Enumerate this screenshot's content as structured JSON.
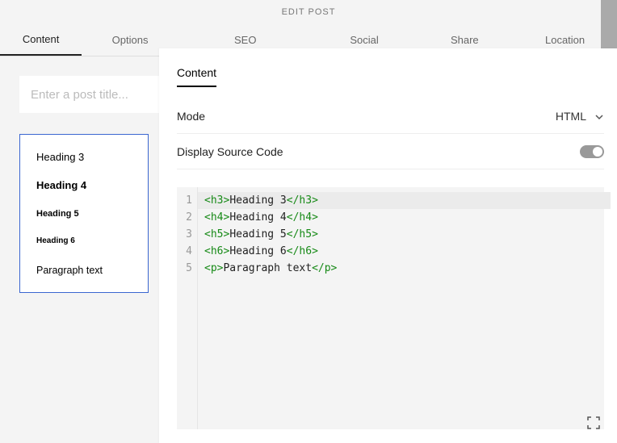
{
  "header": {
    "title": "EDIT POST"
  },
  "tabs": [
    {
      "label": "Content",
      "active": true
    },
    {
      "label": "Options"
    },
    {
      "label": "SEO"
    },
    {
      "label": "Social"
    },
    {
      "label": "Share"
    },
    {
      "label": "Location"
    }
  ],
  "title_input": {
    "placeholder": "Enter a post title..."
  },
  "preview": {
    "h3": "Heading 3",
    "h4": "Heading 4",
    "h5": "Heading 5",
    "h6": "Heading 6",
    "p": "Paragraph text"
  },
  "panel": {
    "tab": "Content",
    "mode_label": "Mode",
    "mode_value": "HTML",
    "display_source_label": "Display Source Code",
    "display_source_on": true
  },
  "code": {
    "numbers": [
      "1",
      "2",
      "3",
      "4",
      "5"
    ],
    "lines": [
      {
        "open": "<h3>",
        "text": "Heading 3",
        "close": "</h3>",
        "hl": true
      },
      {
        "open": "<h4>",
        "text": "Heading 4",
        "close": "</h4>"
      },
      {
        "open": "<h5>",
        "text": "Heading 5",
        "close": "</h5>"
      },
      {
        "open": "<h6>",
        "text": "Heading 6",
        "close": "</h6>"
      },
      {
        "open": "<p>",
        "text": "Paragraph text",
        "close": "</p>"
      }
    ]
  }
}
